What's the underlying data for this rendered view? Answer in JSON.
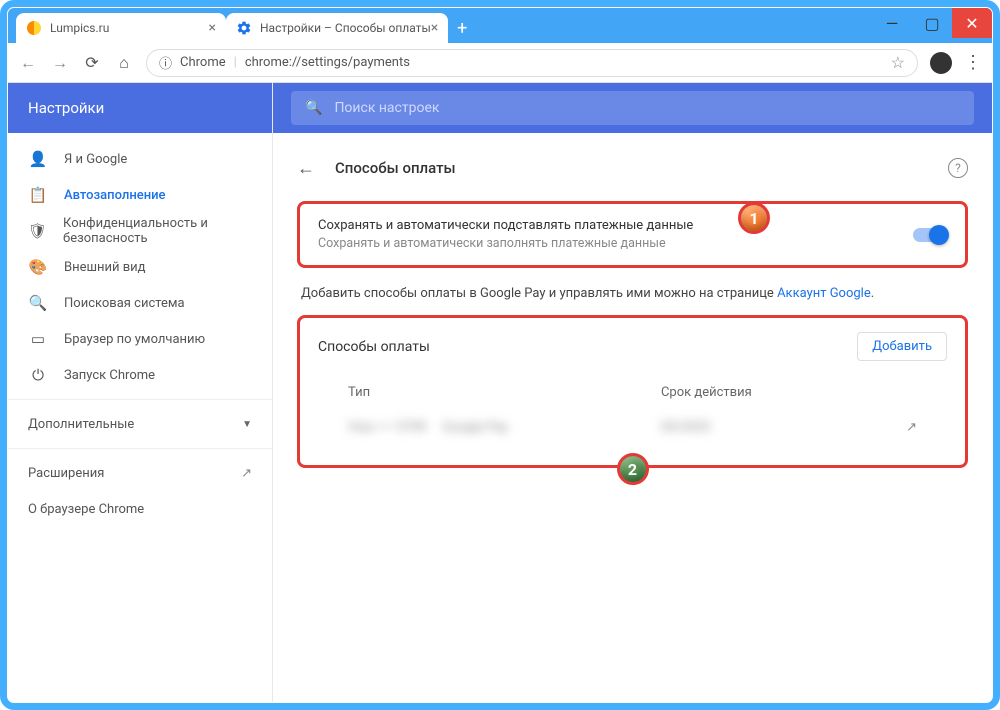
{
  "window": {
    "tabs": [
      {
        "title": "Lumpics.ru",
        "favicon": "lumpics"
      },
      {
        "title": "Настройки – Способы оплаты",
        "favicon": "gear"
      }
    ],
    "controls": {
      "minimize": "—",
      "maximize": "▢",
      "close": "✕"
    }
  },
  "nav": {
    "secure_label": "Chrome",
    "url": "chrome://settings/payments"
  },
  "sidebar": {
    "header": "Настройки",
    "items": [
      {
        "icon": "person",
        "label": "Я и Google"
      },
      {
        "icon": "clipboard",
        "label": "Автозаполнение",
        "active": true
      },
      {
        "icon": "shield",
        "label": "Конфиденциальность и безопасность"
      },
      {
        "icon": "palette",
        "label": "Внешний вид"
      },
      {
        "icon": "search",
        "label": "Поисковая система"
      },
      {
        "icon": "browser",
        "label": "Браузер по умолчанию"
      },
      {
        "icon": "power",
        "label": "Запуск Chrome"
      }
    ],
    "advanced": "Дополнительные",
    "extensions": "Расширения",
    "about": "О браузере Chrome"
  },
  "search": {
    "placeholder": "Поиск настроек"
  },
  "page": {
    "title": "Способы оплаты",
    "setting": {
      "title": "Сохранять и автоматически подставлять платежные данные",
      "desc": "Сохранять и автоматически заполнять платежные данные"
    },
    "gpay_text": "Добавить способы оплаты в Google Pay и управлять ими можно на странице ",
    "gpay_link": "Аккаунт Google",
    "card": {
      "title": "Способы оплаты",
      "add": "Добавить",
      "col_type": "Тип",
      "col_expiry": "Срок действия",
      "row_val1": "Visa •••• 5799",
      "row_val2": "Google Pay",
      "row_expiry": "05/2025"
    }
  },
  "annotations": {
    "b1": "1",
    "b2": "2"
  }
}
